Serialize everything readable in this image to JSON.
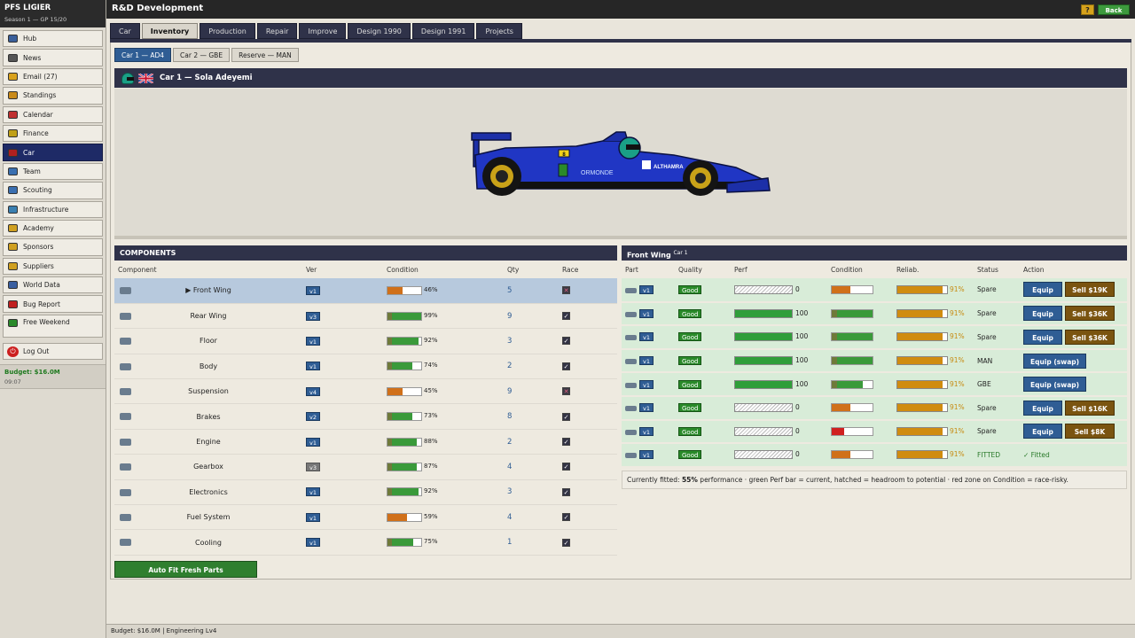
{
  "team": {
    "name": "PFS LIGIER",
    "season": "Season 1 — GP 15/20"
  },
  "sidebar": {
    "items": [
      {
        "label": "Hub",
        "icon": "globe-icon"
      },
      {
        "label": "News",
        "icon": "newspaper-icon"
      },
      {
        "label": "Email (27)",
        "icon": "envelope-icon"
      },
      {
        "label": "Standings",
        "icon": "trophy-icon"
      },
      {
        "label": "Calendar",
        "icon": "calendar-icon"
      },
      {
        "label": "Finance",
        "icon": "coins-icon"
      },
      {
        "label": "Car",
        "icon": "car-icon"
      },
      {
        "label": "Team",
        "icon": "people-icon"
      },
      {
        "label": "Scouting",
        "icon": "magnifier-icon"
      },
      {
        "label": "Infrastructure",
        "icon": "factory-icon"
      },
      {
        "label": "Academy",
        "icon": "graduation-icon"
      },
      {
        "label": "Sponsors",
        "icon": "handshake-icon"
      },
      {
        "label": "Suppliers",
        "icon": "crate-icon"
      },
      {
        "label": "World Data",
        "icon": "book-icon"
      },
      {
        "label": "Bug Report",
        "icon": "bug-icon"
      },
      {
        "label": "Free Weekend",
        "icon": "leaf-icon"
      },
      {
        "label": "Log Out",
        "icon": "power-icon"
      }
    ],
    "budget": "Budget: $16.0M",
    "time": "09:07"
  },
  "topbar": {
    "title": "R&D Development",
    "help_label": "?",
    "back_label": "Back"
  },
  "tabs": [
    "Car",
    "Inventory",
    "Production",
    "Repair",
    "Improve",
    "Design 1990",
    "Design 1991",
    "Projects"
  ],
  "subtabs": [
    "Car 1 — AD4",
    "Car 2 — GBE",
    "Reserve — MAN"
  ],
  "car_header": {
    "driver": "Car 1 — Sola Adeyemi"
  },
  "car_livery": {
    "sponsor1": "ORMONDE",
    "sponsor2": "ALTHAMRA",
    "number": "8"
  },
  "components": {
    "title": "COMPONENTS",
    "columns": [
      "Component",
      "Ver",
      "Condition",
      "Qty",
      "Race"
    ],
    "rows": [
      {
        "name": "▶ Front Wing",
        "ver": "v1",
        "cond": 46,
        "qty": "5",
        "race": false,
        "icon": "front-wing-icon"
      },
      {
        "name": "Rear Wing",
        "ver": "v3",
        "cond": 99,
        "qty": "9",
        "race": true,
        "icon": "rear-wing-icon"
      },
      {
        "name": "Floor",
        "ver": "v1",
        "cond": 92,
        "qty": "3",
        "race": true,
        "icon": "floor-icon"
      },
      {
        "name": "Body",
        "ver": "v1",
        "cond": 74,
        "qty": "2",
        "race": true,
        "icon": "body-icon"
      },
      {
        "name": "Suspension",
        "ver": "v4",
        "cond": 45,
        "qty": "9",
        "race": false,
        "icon": "suspension-icon"
      },
      {
        "name": "Brakes",
        "ver": "v2",
        "cond": 73,
        "qty": "8",
        "race": true,
        "icon": "brakes-icon"
      },
      {
        "name": "Engine",
        "ver": "v1",
        "cond": 88,
        "qty": "2",
        "race": true,
        "icon": "engine-icon"
      },
      {
        "name": "Gearbox",
        "ver": "v3",
        "cond": 87,
        "qty": "4",
        "race": true,
        "icon": "gearbox-icon"
      },
      {
        "name": "Electronics",
        "ver": "v1",
        "cond": 92,
        "qty": "3",
        "race": true,
        "icon": "electronics-icon"
      },
      {
        "name": "Fuel System",
        "ver": "v1",
        "cond": 59,
        "qty": "4",
        "race": true,
        "icon": "fuel-system-icon"
      },
      {
        "name": "Cooling",
        "ver": "v1",
        "cond": 75,
        "qty": "1",
        "race": true,
        "icon": "cooling-icon"
      }
    ],
    "autofit_label": "Auto Fit Fresh Parts"
  },
  "front_wing": {
    "title": "Front Wing",
    "subtitle": "Car 1",
    "columns": [
      "Part",
      "Quality",
      "Perf",
      "Condition",
      "Reliab.",
      "Status",
      "Action"
    ],
    "rows": [
      {
        "ver": "v1",
        "quality": "Good",
        "perf": 0,
        "cond": 46,
        "rel": "91%",
        "status": "Spare",
        "equip": "Equip",
        "sell": "Sell $19K"
      },
      {
        "ver": "v1",
        "quality": "Good",
        "perf": 100,
        "cond": 99,
        "rel": "91%",
        "status": "Spare",
        "equip": "Equip",
        "sell": "Sell $36K"
      },
      {
        "ver": "v1",
        "quality": "Good",
        "perf": 100,
        "cond": 99,
        "rel": "91%",
        "status": "Spare",
        "equip": "Equip",
        "sell": "Sell $36K"
      },
      {
        "ver": "v1",
        "quality": "Good",
        "perf": 100,
        "cond": 99,
        "rel": "91%",
        "status": "MAN",
        "equip": "Equip (swap)",
        "sell": ""
      },
      {
        "ver": "v1",
        "quality": "Good",
        "perf": 100,
        "cond": 75,
        "rel": "91%",
        "status": "GBE",
        "equip": "Equip (swap)",
        "sell": ""
      },
      {
        "ver": "v1",
        "quality": "Good",
        "perf": 0,
        "cond": 45,
        "rel": "91%",
        "status": "Spare",
        "equip": "Equip",
        "sell": "Sell $16K"
      },
      {
        "ver": "v1",
        "quality": "Good",
        "perf": 0,
        "cond": 30,
        "rel": "91%",
        "status": "Spare",
        "equip": "Equip",
        "sell": "Sell $8K"
      },
      {
        "ver": "v1",
        "quality": "Good",
        "perf": 0,
        "cond": 46,
        "rel": "91%",
        "status": "FITTED",
        "equip": "",
        "sell": "",
        "fitted_label": "✓ Fitted"
      }
    ],
    "note_prefix": "Currently fitted: ",
    "note_value": "55%",
    "note_suffix": " performance · green Perf bar = current, hatched = headroom to potential · red zone on Condition = race-risky."
  },
  "footer": "Budget: $16.0M | Engineering Lv4",
  "colors": {
    "navy": "#2f3249",
    "blue": "#2f5d94",
    "green": "#2f9e3a",
    "orange": "#d08c10",
    "sell": "#7a5410"
  }
}
